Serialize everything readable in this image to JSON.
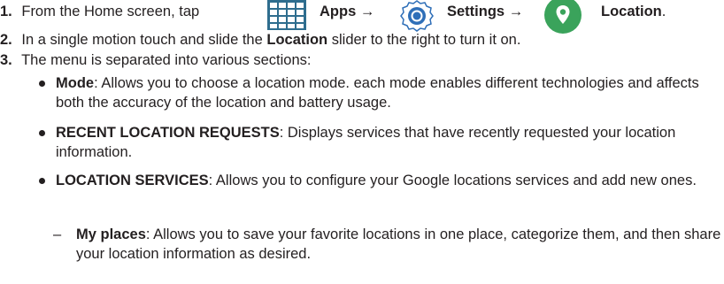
{
  "steps": [
    {
      "number": "1.",
      "intro": "From the Home screen, tap",
      "apps": "Apps",
      "arrow1": "→",
      "settings": "Settings",
      "arrow2": "→",
      "location": "Location",
      "end": ".",
      "icons": [
        "apps-grid-icon",
        "settings-gear-icon",
        "location-pin-icon"
      ]
    },
    {
      "number": "2.",
      "pre": "In a single motion touch and slide the",
      "bold": "Location",
      "post": "slider to the right to turn it on."
    },
    {
      "number": "3.",
      "text": "The menu is separated into various sections:"
    }
  ],
  "sections": [
    {
      "title": "Mode",
      "text": ": Allows you to choose a location mode. each mode enables different technologies and affects both the accuracy of the location and battery usage."
    },
    {
      "title": "RECENT LOCATION REQUESTS",
      "text": ": Displays services that have recently requested your location information."
    },
    {
      "title": "LOCATION SERVICES",
      "text": ": Allows you to configure your Google locations services and add new ones."
    }
  ],
  "subsection": {
    "dash": "–",
    "title": "My places",
    "text": ": Allows you to save your favorite locations in one place, categorize them, and then share your location information as desired."
  },
  "colors": {
    "text": "#231f20",
    "apps_icon": "#2e6d8e",
    "settings_icon": "#2f6fb8",
    "location_icon": "#3aa35b"
  }
}
